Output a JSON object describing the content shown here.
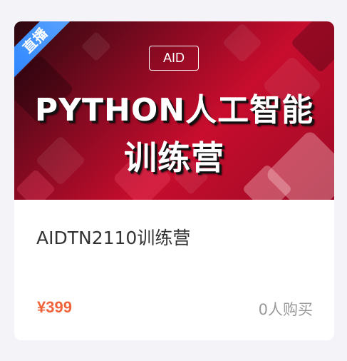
{
  "course_card": {
    "banner": {
      "live_badge": "直播",
      "tag": "AID",
      "title_line1": "PYTHON人工智能",
      "title_line2": "训练营"
    },
    "name": "AIDTN2110训练营",
    "price": "¥399",
    "buyers": "0人购买"
  },
  "colors": {
    "banner_red": "#c80d2e",
    "live_badge_blue": "#3d8ef8",
    "price_orange": "#f0633a",
    "muted_gray": "#999999"
  }
}
